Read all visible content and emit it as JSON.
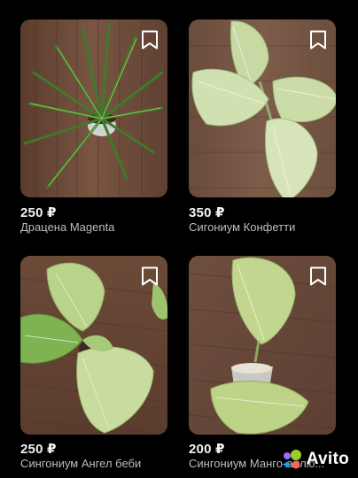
{
  "listings": [
    {
      "price": "250 ₽",
      "title": "Драцена Magenta",
      "favorited": false
    },
    {
      "price": "350 ₽",
      "title": "Сигониум Конфетти",
      "favorited": false
    },
    {
      "price": "250 ₽",
      "title": "Сингониум Ангел беби",
      "favorited": false
    },
    {
      "price": "200 ₽",
      "title": "Сингониум Манго-аллю...",
      "favorited": false
    }
  ],
  "watermark": {
    "brand": "Avito",
    "logo_colors": [
      "#97cf26",
      "#a169f7",
      "#ff6163",
      "#00aaff"
    ]
  },
  "colors": {
    "background": "#000000",
    "price": "#f2f2f2",
    "title": "#bdbdbd"
  }
}
